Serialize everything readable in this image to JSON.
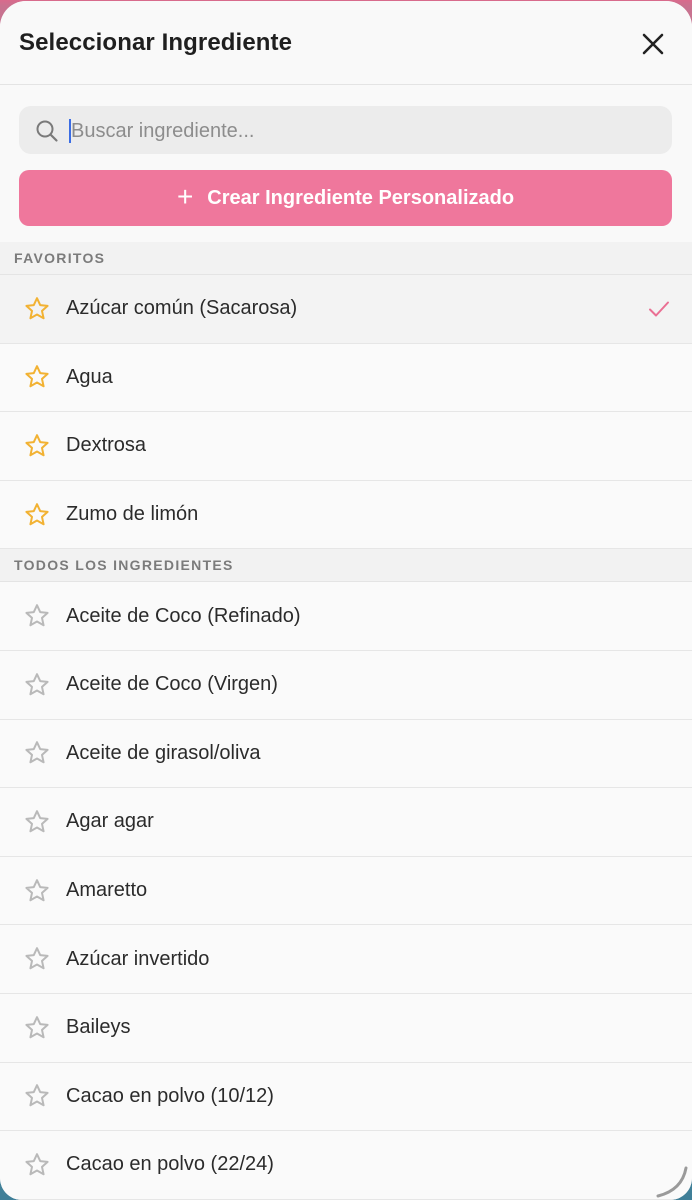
{
  "header": {
    "title": "Seleccionar Ingrediente"
  },
  "search": {
    "placeholder": "Buscar ingrediente..."
  },
  "create_button": {
    "plus": "+",
    "label": "Crear Ingrediente Personalizado"
  },
  "sections": {
    "favorites": {
      "title": "FAVORITOS",
      "items": [
        {
          "label": "Azúcar común (Sacarosa)",
          "favorite": true,
          "selected": true
        },
        {
          "label": "Agua",
          "favorite": true,
          "selected": false
        },
        {
          "label": "Dextrosa",
          "favorite": true,
          "selected": false
        },
        {
          "label": "Zumo de limón",
          "favorite": true,
          "selected": false
        }
      ]
    },
    "all": {
      "title": "TODOS LOS INGREDIENTES",
      "items": [
        {
          "label": "Aceite de Coco (Refinado)",
          "favorite": false
        },
        {
          "label": "Aceite de Coco (Virgen)",
          "favorite": false
        },
        {
          "label": "Aceite de girasol/oliva",
          "favorite": false
        },
        {
          "label": "Agar agar",
          "favorite": false
        },
        {
          "label": "Amaretto",
          "favorite": false
        },
        {
          "label": "Azúcar invertido",
          "favorite": false
        },
        {
          "label": "Baileys",
          "favorite": false
        },
        {
          "label": "Cacao en polvo (10/12)",
          "favorite": false
        },
        {
          "label": "Cacao en polvo (22/24)",
          "favorite": false
        }
      ]
    }
  },
  "icons": {
    "close": "close-icon",
    "search": "search-icon",
    "star_filled": "star-filled-icon",
    "star_outline": "star-outline-icon",
    "check": "checkmark-icon"
  },
  "colors": {
    "accent": "#ef779c",
    "star_filled": "#f2b233",
    "star_outline": "#b9b9b9",
    "check": "#ea6f93"
  }
}
